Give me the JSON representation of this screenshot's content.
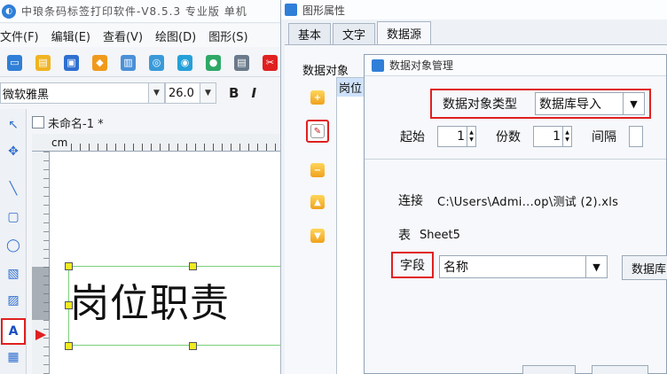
{
  "app": {
    "title": "中琅条码标签打印软件-V8.5.3 专业版 单机",
    "logo_glyph": "◐",
    "menu": [
      "文件(F)",
      "编辑(E)",
      "查看(V)",
      "绘图(D)",
      "图形(S)"
    ],
    "toolbar_icons": [
      {
        "name": "new-icon",
        "color": "#2f7fd8",
        "glyph": "▭"
      },
      {
        "name": "open-folder-icon",
        "color": "#f0b323",
        "glyph": "▤"
      },
      {
        "name": "save-icon",
        "color": "#2f6fd0",
        "glyph": "▣"
      },
      {
        "name": "layers-icon",
        "color": "#f09a1c",
        "glyph": "◆"
      },
      {
        "name": "print-icon",
        "color": "#4a90d9",
        "glyph": "▥"
      },
      {
        "name": "print-preview-icon",
        "color": "#3a9ad9",
        "glyph": "◎"
      },
      {
        "name": "database-icon",
        "color": "#25a0d8",
        "glyph": "◉"
      },
      {
        "name": "globe-icon",
        "color": "#2fa866",
        "glyph": "●"
      },
      {
        "name": "tools-icon",
        "color": "#6a7a8a",
        "glyph": "▤"
      },
      {
        "name": "cut-icon",
        "color": "#e02020",
        "glyph": "✂"
      }
    ],
    "font_name": "微软雅黑",
    "font_size": "26.0",
    "bold_label": "B",
    "italic_label": "I",
    "doc_tab": "未命名-1 *",
    "ruler_unit": "cm",
    "canvas_text": "岗位职责",
    "left_tools": [
      {
        "name": "select-arrow-icon",
        "glyph": "↖",
        "active": false
      },
      {
        "name": "pan-icon",
        "glyph": "✥",
        "active": false
      },
      {
        "name": "line-icon",
        "glyph": "╲",
        "active": false
      },
      {
        "name": "rounded-rect-icon",
        "glyph": "▢",
        "active": false
      },
      {
        "name": "ellipse-icon",
        "glyph": "◯",
        "active": false
      },
      {
        "name": "image-icon",
        "glyph": "▧",
        "active": false
      },
      {
        "name": "picture-icon",
        "glyph": "▨",
        "active": false
      },
      {
        "name": "text-tool-icon",
        "glyph": "A",
        "active": true
      },
      {
        "name": "barcode-icon",
        "glyph": "▦",
        "active": false
      }
    ]
  },
  "props": {
    "title": "图形属性",
    "tabs": [
      "基本",
      "文字",
      "数据源"
    ],
    "active_tab": 2,
    "data_object_label": "数据对象",
    "list_items": [
      "岗位"
    ]
  },
  "dialog": {
    "title": "数据对象管理",
    "type_label": "数据对象类型",
    "type_value": "数据库导入",
    "start_label": "起始",
    "start_value": "1",
    "count_label": "份数",
    "count_value": "1",
    "interval_label": "间隔",
    "connect_label": "连接",
    "connect_value": "C:\\Users\\Admi...op\\测试 (2).xls",
    "table_label": "表",
    "table_value": "Sheet5",
    "field_label": "字段",
    "field_value": "名称",
    "db_button": "数据库"
  },
  "colors": {
    "highlight": "#e02020",
    "accent": "#2f7fd8",
    "handle": "#f2ea22",
    "selection": "#7bd07b"
  }
}
